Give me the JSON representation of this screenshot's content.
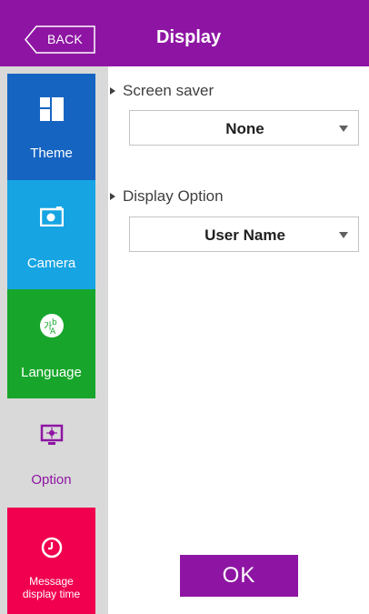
{
  "header": {
    "back_label": "BACK",
    "title": "Display",
    "color": "#8e15a3"
  },
  "sidebar": {
    "items": [
      {
        "label": "Theme",
        "icon": "theme-icon",
        "color": "#1664c2"
      },
      {
        "label": "Camera",
        "icon": "camera-icon",
        "color": "#16a4e3"
      },
      {
        "label": "Language",
        "icon": "language-icon",
        "color": "#17a62b"
      },
      {
        "label": "Option",
        "icon": "option-icon",
        "color": "#d9d9d9",
        "selected": true
      },
      {
        "label_line1": "Message",
        "label_line2": "display time",
        "icon": "clock-icon",
        "color": "#f0004f"
      }
    ]
  },
  "main": {
    "screen_saver": {
      "label": "Screen saver",
      "value": "None"
    },
    "display_option": {
      "label": "Display Option",
      "value": "User Name"
    },
    "ok_label": "OK"
  }
}
